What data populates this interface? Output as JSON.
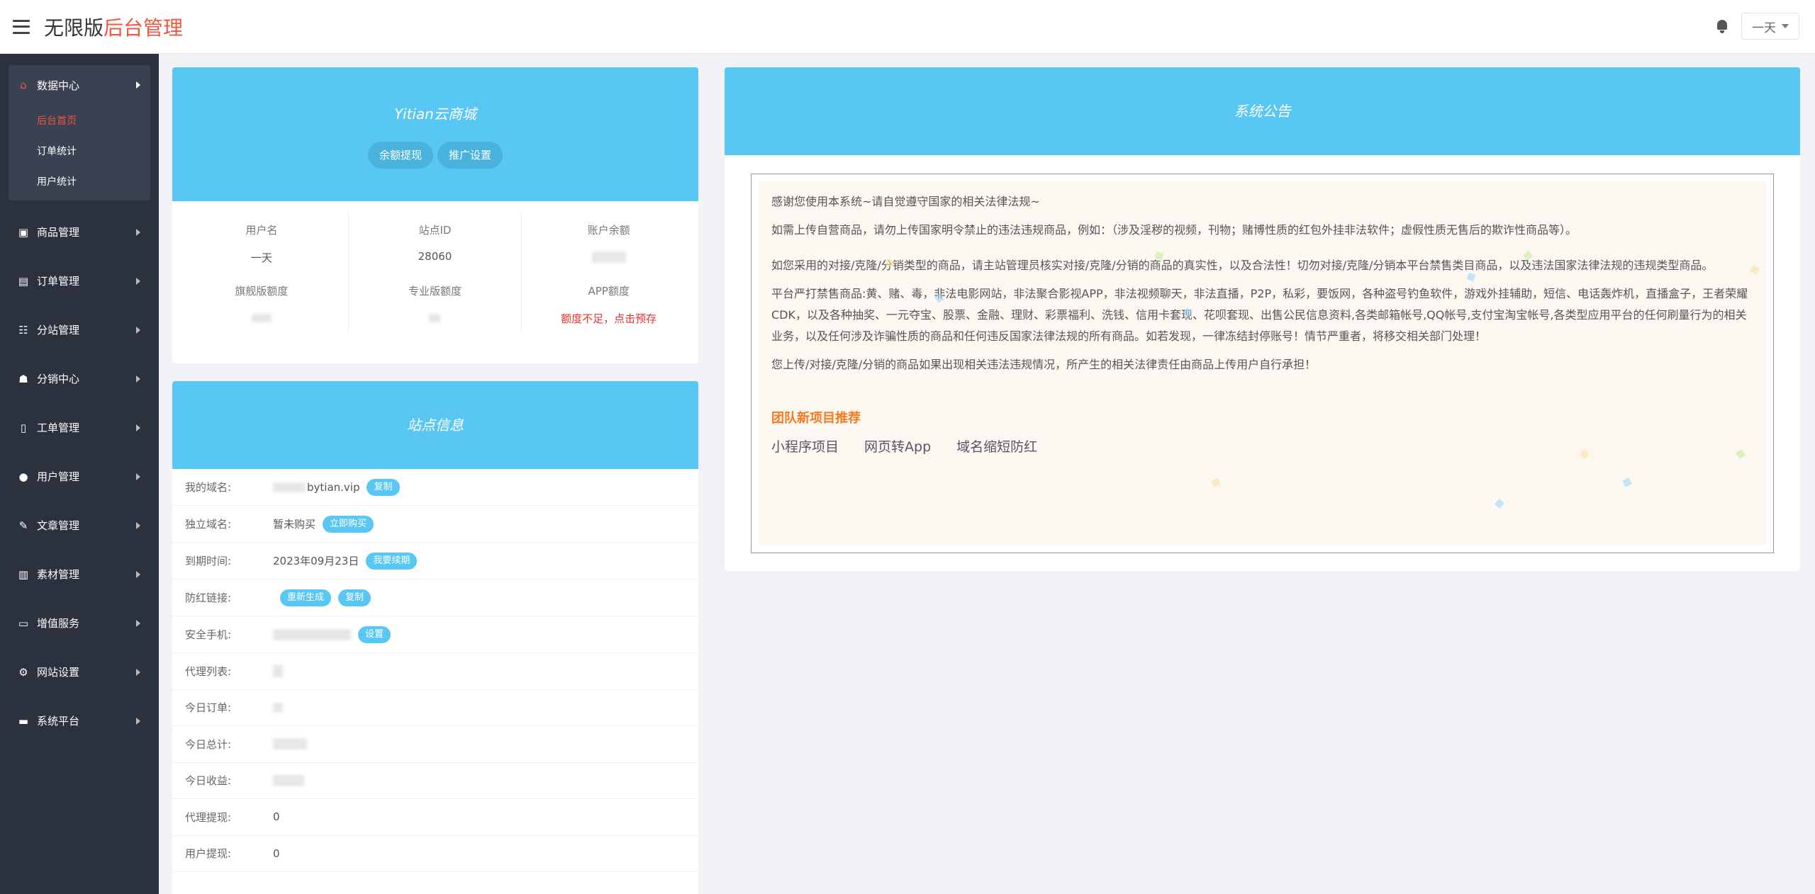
{
  "header": {
    "brand_plain": "无限版",
    "brand_accent": "后台管理",
    "user_name": "一天"
  },
  "sidebar": {
    "group": {
      "label": "数据中心",
      "icon": "home-icon",
      "items": [
        {
          "label": "后台首页",
          "active": true
        },
        {
          "label": "订单统计"
        },
        {
          "label": "用户统计"
        }
      ]
    },
    "items": [
      {
        "label": "商品管理",
        "icon": "gift-icon"
      },
      {
        "label": "订单管理",
        "icon": "cart-icon"
      },
      {
        "label": "分站管理",
        "icon": "sitemap-icon"
      },
      {
        "label": "分销中心",
        "icon": "user-secret-icon"
      },
      {
        "label": "工单管理",
        "icon": "file-icon"
      },
      {
        "label": "用户管理",
        "icon": "users-icon"
      },
      {
        "label": "文章管理",
        "icon": "edit-icon"
      },
      {
        "label": "素材管理",
        "icon": "book-icon"
      },
      {
        "label": "增值服务",
        "icon": "desktop-icon"
      },
      {
        "label": "网站设置",
        "icon": "cogs-icon"
      },
      {
        "label": "系统平台",
        "icon": "laptop-icon"
      }
    ]
  },
  "shop": {
    "title": "Yitian云商城",
    "withdraw_button": "余额提现",
    "promo_button": "推广设置",
    "stats": [
      {
        "label": "用户名",
        "value": "一天"
      },
      {
        "label": "站点ID",
        "value": "28060"
      },
      {
        "label": "账户余额",
        "value": ""
      },
      {
        "label": "旗舰版额度",
        "value": ""
      },
      {
        "label": "专业版额度",
        "value": ""
      },
      {
        "label": "APP额度",
        "value": "额度不足，点击预存"
      }
    ]
  },
  "site": {
    "title": "站点信息",
    "rows": {
      "domain": {
        "label": "我的域名:",
        "value": "bytian.vip",
        "tag": "复制"
      },
      "custom_domain": {
        "label": "独立域名:",
        "value": "暂未购买",
        "tag": "立即购买"
      },
      "expire": {
        "label": "到期时间:",
        "value": "2023年09月23日",
        "tag": "我要续期"
      },
      "antired": {
        "label": "防红链接:",
        "tag1": "重新生成",
        "tag2": "复制"
      },
      "phone": {
        "label": "安全手机:",
        "tag": "设置"
      },
      "agents": {
        "label": "代理列表:"
      },
      "today_orders": {
        "label": "今日订单:"
      },
      "today_total": {
        "label": "今日总计:"
      },
      "today_income": {
        "label": "今日收益:"
      },
      "agent_withdraw": {
        "label": "代理提现:",
        "value": "0"
      },
      "user_withdraw": {
        "label": "用户提现:",
        "value": "0"
      }
    }
  },
  "notice": {
    "title": "系统公告",
    "paragraphs": [
      "感谢您使用本系统~请自觉遵守国家的相关法律法规~",
      "如需上传自营商品，请勿上传国家明令禁止的违法违规商品，例如：（涉及淫秽的视频，刊物；赌博性质的红包外挂非法软件；虚假性质无售后的欺诈性商品等）。",
      "如您采用的对接/克隆/分销类型的商品，请主站管理员核实对接/克隆/分销的商品的真实性，以及合法性！切勿对接/克隆/分销本平台禁售类目商品，以及违法国家法律法规的违规类型商品。",
      "平台严打禁售商品:黄、赌、毒，非法电影网站，非法聚合影视APP，非法视频聊天，非法直播，P2P，私彩，要饭网，各种盗号钓鱼软件，游戏外挂辅助，短信、电话轰炸机，直播盒子，王者荣耀CDK，以及各种抽奖、一元夺宝、股票、金融、理财、彩票福利、洗钱、信用卡套现、花呗套现、出售公民信息资料,各类邮箱帐号,QQ帐号,支付宝淘宝帐号,各类型应用平台的任何刷量行为的相关业务，以及任何涉及诈骗性质的商品和任何违反国家法律法规的所有商品。如若发现，一律冻结封停账号！情节严重者，将移交相关部门处理！",
      "您上传/对接/克隆/分销的商品如果出现相关违法违规情况，所产生的相关法律责任由商品上传用户自行承担！"
    ],
    "team_title": "团队新项目推荐",
    "team_links": [
      "小程序项目",
      "网页转App",
      "域名缩短防红"
    ]
  },
  "colors": {
    "accent": "#f0553f",
    "panel_head": "#59c7f3",
    "sidebar": "#2b313d",
    "warn": "#e8322a",
    "team_title": "#f5791d"
  }
}
